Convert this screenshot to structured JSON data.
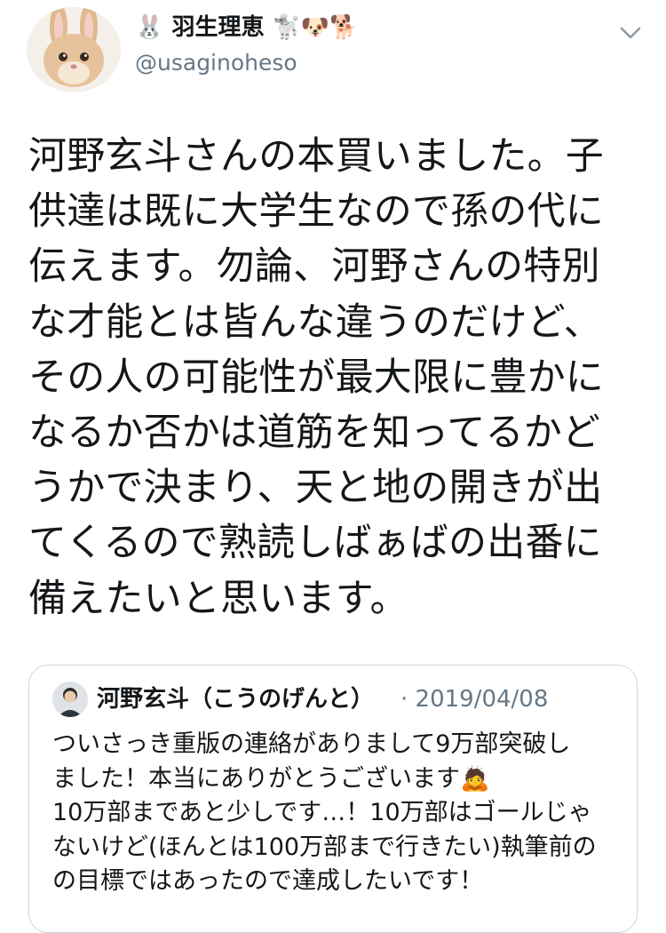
{
  "tweet": {
    "author": {
      "display_name": "羽生理恵",
      "name_prefix_emoji": "🐰",
      "name_suffix_emoji": "🐩🐶🐕",
      "handle": "@usaginoheso",
      "avatar_icon": "rabbit-avatar"
    },
    "menu_icon": "chevron-down-icon",
    "text": "河野玄斗さんの本買いました。子\n供達は既に大学生なので孫の代に\n伝えます。勿論、河野さんの特別\nな才能とは皆んな違うのだけど、\nその人の可能性が最大限に豊かに\nなるか否かは道筋を知ってるかど\nうかで決まり、天と地の開きが出\nてくるので熟読しばぁばの出番に\n備えたいと思います。"
  },
  "quoted_tweet": {
    "author_name": "河野玄斗（こうのげんと）",
    "date": "· 2019/04/08",
    "avatar_icon": "person-avatar",
    "text": "ついさっき重版の連絡がありまして9万部突破し\nました！本当にありがとうございます🙇\n10万部まであと少しです…！10万部はゴールじゃ\nないけど(ほんとは100万部まで行きたい)執筆前の\nの目標ではあったので達成したいです！"
  },
  "colors": {
    "text": "#14171a",
    "secondary": "#657786",
    "border": "#ccd6dd"
  }
}
